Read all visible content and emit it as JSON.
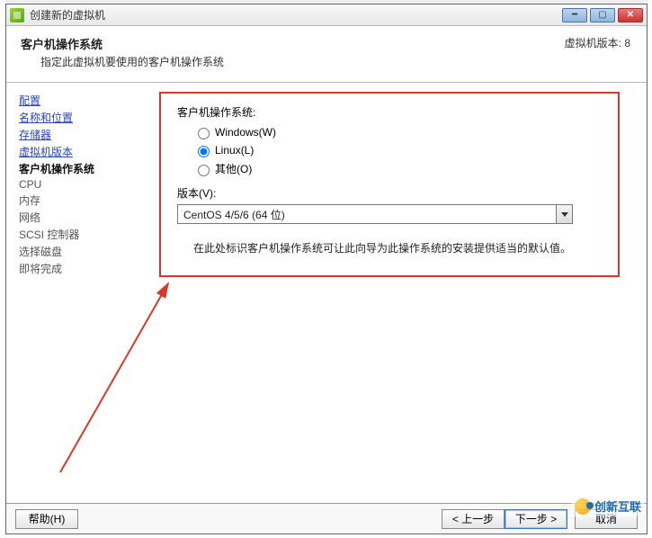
{
  "window": {
    "title": "创建新的虚拟机"
  },
  "header": {
    "title": "客户机操作系统",
    "subtitle": "指定此虚拟机要使用的客户机操作系统",
    "right_label": "虚拟机版本: 8"
  },
  "sidebar": {
    "items": [
      {
        "label": "配置",
        "type": "link"
      },
      {
        "label": "名称和位置",
        "type": "link"
      },
      {
        "label": "存储器",
        "type": "link"
      },
      {
        "label": "虚拟机版本",
        "type": "link"
      },
      {
        "label": "客户机操作系统",
        "type": "active"
      },
      {
        "label": "CPU",
        "type": "plain"
      },
      {
        "label": "内存",
        "type": "plain"
      },
      {
        "label": "网络",
        "type": "plain"
      },
      {
        "label": "SCSI 控制器",
        "type": "plain"
      },
      {
        "label": "选择磁盘",
        "type": "plain"
      },
      {
        "label": "即将完成",
        "type": "plain"
      }
    ]
  },
  "main": {
    "os_label": "客户机操作系统:",
    "radios": {
      "windows": "Windows(W)",
      "linux": "Linux(L)",
      "other": "其他(O)",
      "selected": "linux"
    },
    "version_label": "版本(V):",
    "version_value": "CentOS 4/5/6 (64 位)",
    "hint": "在此处标识客户机操作系统可让此向导为此操作系统的安装提供适当的默认值。"
  },
  "footer": {
    "help": "帮助(H)",
    "back": "< 上一步",
    "next": "下一步 >",
    "cancel": "取消"
  },
  "watermark": "创新互联"
}
